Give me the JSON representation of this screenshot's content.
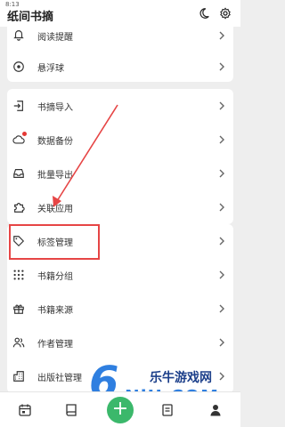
{
  "status_bar": {
    "time": "8:13"
  },
  "header": {
    "title": "纸间书摘",
    "icons": [
      "moon-icon",
      "gear-icon"
    ]
  },
  "group1": {
    "items": [
      {
        "label": "阅读提醒",
        "icon": "bell-icon"
      },
      {
        "label": "悬浮球",
        "icon": "floating-ball-icon"
      }
    ]
  },
  "group2": {
    "items": [
      {
        "label": "书摘导入",
        "icon": "import-icon"
      },
      {
        "label": "数据备份",
        "icon": "cloud-icon",
        "badge_color": "#e53935"
      },
      {
        "label": "批量导出",
        "icon": "inbox-icon"
      },
      {
        "label": "关联应用",
        "icon": "puzzle-icon"
      }
    ]
  },
  "group3": {
    "items": [
      {
        "label": "标签管理",
        "icon": "tag-icon",
        "highlighted": true
      },
      {
        "label": "书籍分组",
        "icon": "grid-icon"
      },
      {
        "label": "书籍来源",
        "icon": "gift-icon"
      },
      {
        "label": "作者管理",
        "icon": "users-icon"
      },
      {
        "label": "出版社管理",
        "icon": "building-icon"
      }
    ]
  },
  "annotation": {
    "highlight_color": "#e64545",
    "arrow_color": "#e64545"
  },
  "bottom_nav": {
    "items": [
      "calendar-icon",
      "book-icon",
      "add-icon",
      "document-icon",
      "profile-icon"
    ],
    "fab_label": "+",
    "accent": "#3bb86b"
  },
  "watermark": {
    "brand": "6",
    "text": "乐牛游戏网",
    "url": "NiU.COM"
  }
}
